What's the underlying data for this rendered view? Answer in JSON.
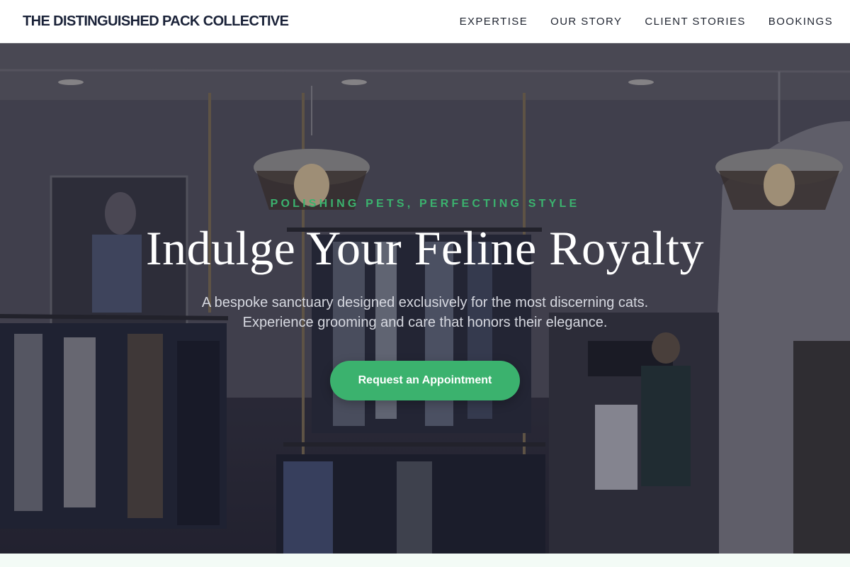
{
  "header": {
    "brand": "THE DISTINGUISHED PACK COLLECTIVE",
    "nav": [
      {
        "label": "EXPERTISE"
      },
      {
        "label": "OUR STORY"
      },
      {
        "label": "CLIENT STORIES"
      },
      {
        "label": "BOOKINGS"
      }
    ]
  },
  "hero": {
    "tagline": "POLISHING PETS, PERFECTING STYLE",
    "headline": "Indulge Your Feline Royalty",
    "subtext_line1": "A bespoke sanctuary designed exclusively for the most discerning cats.",
    "subtext_line2": "Experience grooming and care that honors their elegance.",
    "cta_label": "Request an Appointment",
    "background_image": "clothing boutique interior with hanging pendant lamps and garment racks"
  },
  "colors": {
    "accent": "#3bb26e",
    "brand_text": "#1a2238",
    "below_fold": "#f3fbf6"
  }
}
